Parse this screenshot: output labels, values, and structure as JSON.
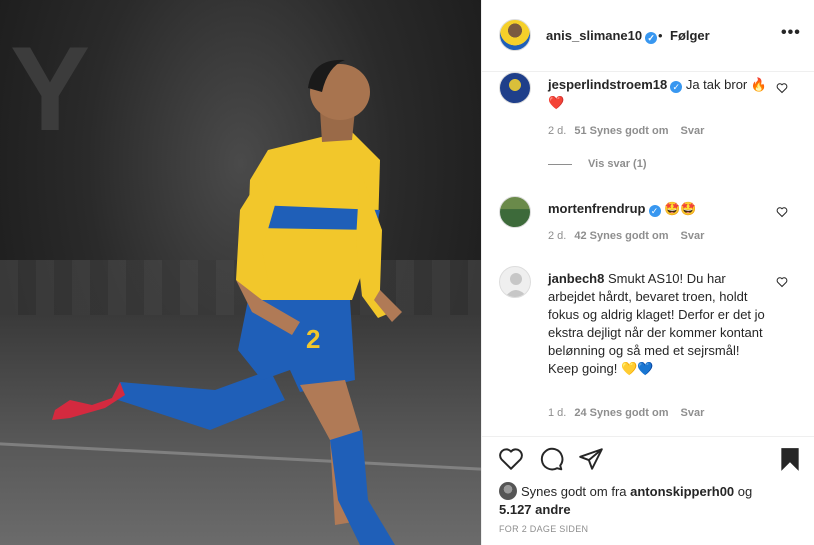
{
  "header": {
    "username": "anis_slimane10",
    "verified_mark": "✓",
    "separator": "•",
    "follow_status": "Følger",
    "more_icon": "•••"
  },
  "comments": [
    {
      "username": "jesperlindstroem18",
      "verified": true,
      "text": "Ja tak bror 🔥❤️",
      "time": "2 d.",
      "likes": "51 Synes godt om",
      "reply": "Svar",
      "view_replies": "Vis svar (1)"
    },
    {
      "username": "mortenfrendrup",
      "verified": true,
      "text": "🤩🤩",
      "time": "2 d.",
      "likes": "42 Synes godt om",
      "reply": "Svar"
    },
    {
      "username": "janbech8",
      "verified": false,
      "text": "Smukt AS10! Du har arbejdet hårdt, bevaret troen, holdt fokus og aldrig klaget! Derfor er det jo ekstra dejligt når der kommer kontant belønning og så med et sejrsmål! Keep going! 💛💙",
      "time": "1 d.",
      "likes": "24 Synes godt om",
      "reply": "Svar"
    }
  ],
  "actions": {
    "like_icon": "heart-outline-icon",
    "comment_icon": "comment-bubble-icon",
    "share_icon": "paper-plane-icon",
    "save_icon": "bookmark-filled-icon"
  },
  "likes_summary": {
    "prefix": "Synes godt om fra",
    "user": "antonskipperh00",
    "joiner": "og",
    "others": "5.127 andre"
  },
  "time_ago": "FOR 2 DAGE SIDEN",
  "colors": {
    "verified": "#3897f0",
    "jersey_yellow": "#f2c72b",
    "jersey_blue": "#1f5fb8",
    "text": "#262626",
    "muted": "#8e8e8e"
  }
}
